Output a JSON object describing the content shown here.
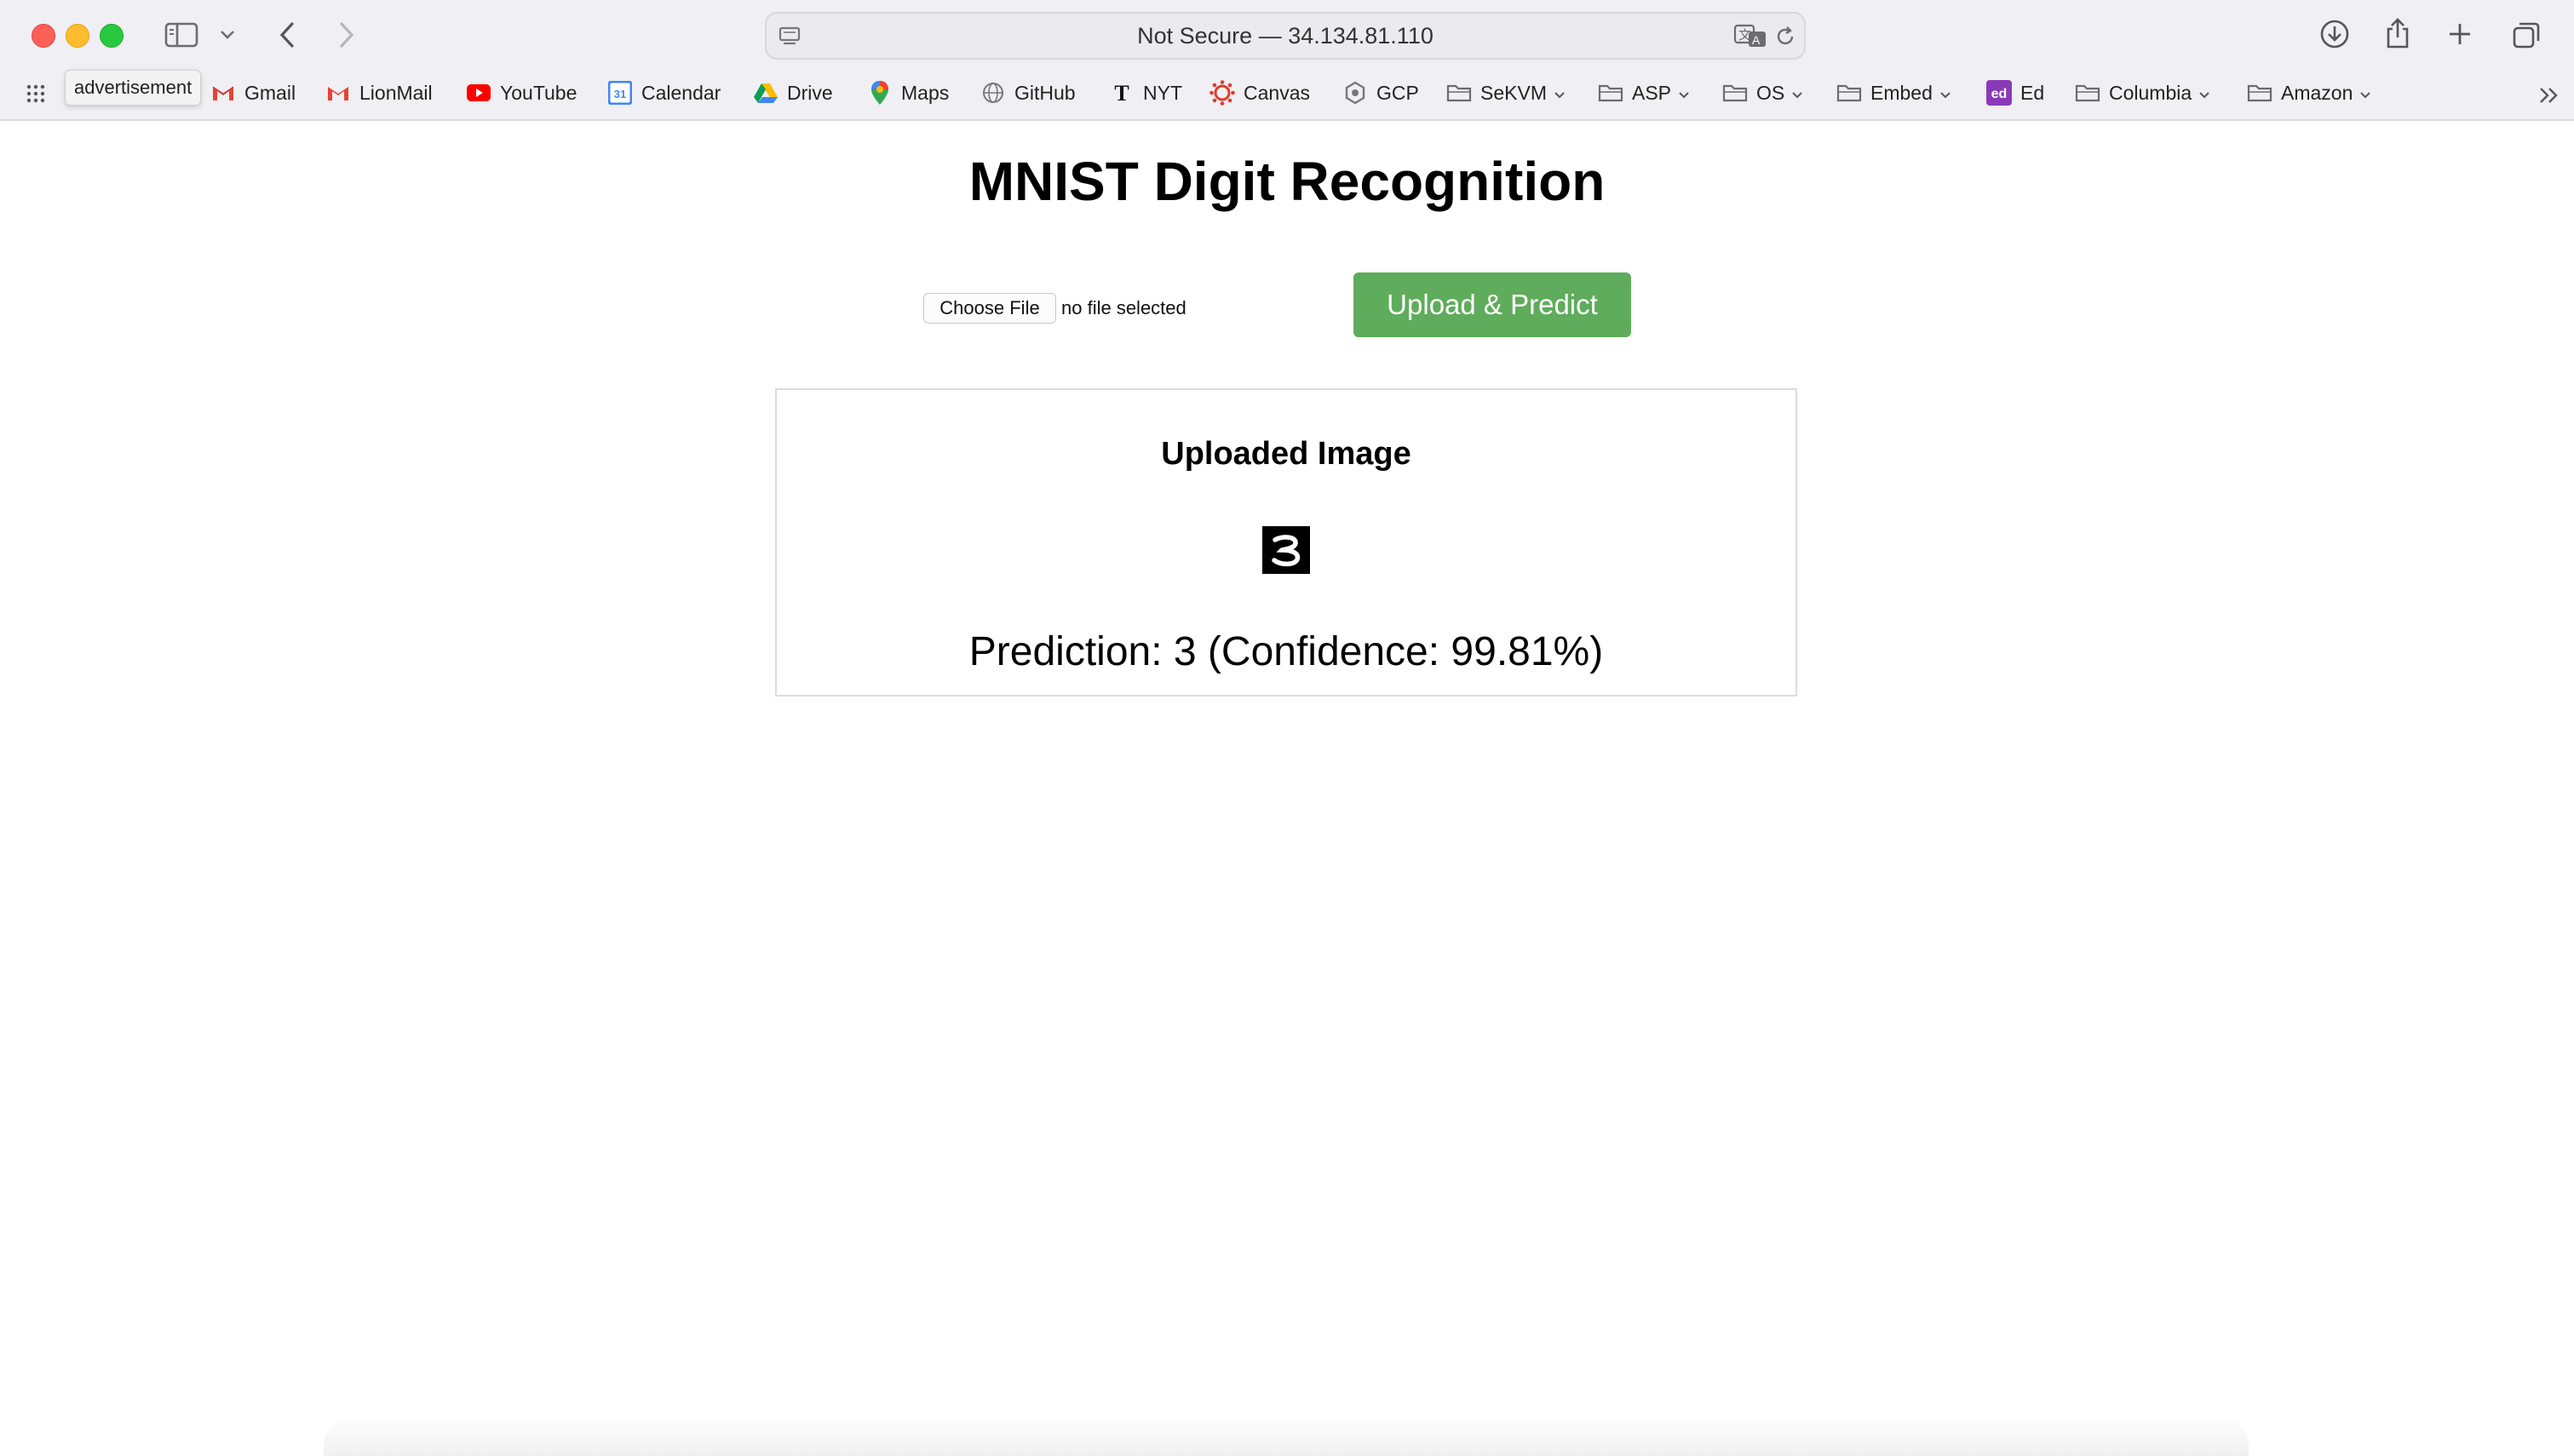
{
  "browser": {
    "url_display": "Not Secure — 34.134.81.110",
    "tooltip": "advertisement",
    "bookmarks": [
      {
        "label": "Gmail",
        "icon": "gmail-icon"
      },
      {
        "label": "LionMail",
        "icon": "gmail-icon"
      },
      {
        "label": "YouTube",
        "icon": "youtube-icon"
      },
      {
        "label": "Calendar",
        "icon": "calendar-icon",
        "icon_text": "31"
      },
      {
        "label": "Drive",
        "icon": "drive-icon"
      },
      {
        "label": "Maps",
        "icon": "maps-icon"
      },
      {
        "label": "GitHub",
        "icon": "globe-icon"
      },
      {
        "label": "NYT",
        "icon": "nyt-icon",
        "icon_text": "T"
      },
      {
        "label": "Canvas",
        "icon": "canvas-icon"
      },
      {
        "label": "GCP",
        "icon": "gcp-icon"
      },
      {
        "label": "SeKVM",
        "icon": "folder-icon",
        "folder": true
      },
      {
        "label": "ASP",
        "icon": "folder-icon",
        "folder": true
      },
      {
        "label": "OS",
        "icon": "folder-icon",
        "folder": true
      },
      {
        "label": "Embed",
        "icon": "folder-icon",
        "folder": true
      },
      {
        "label": "Ed",
        "icon": "ed-icon",
        "icon_text": "ed"
      },
      {
        "label": "Columbia",
        "icon": "folder-icon",
        "folder": true
      },
      {
        "label": "Amazon",
        "icon": "folder-icon",
        "folder": true
      }
    ]
  },
  "page": {
    "title": "MNIST Digit Recognition",
    "file_button": "Choose File",
    "file_status": "no file selected",
    "upload_button": "Upload & Predict",
    "result": {
      "heading": "Uploaded Image",
      "digit_image_text": "3",
      "prediction": "Prediction: 3 (Confidence: 99.81%)"
    }
  },
  "colors": {
    "upload_button": "#5fac5c",
    "chrome_bg": "#f0eff3"
  }
}
